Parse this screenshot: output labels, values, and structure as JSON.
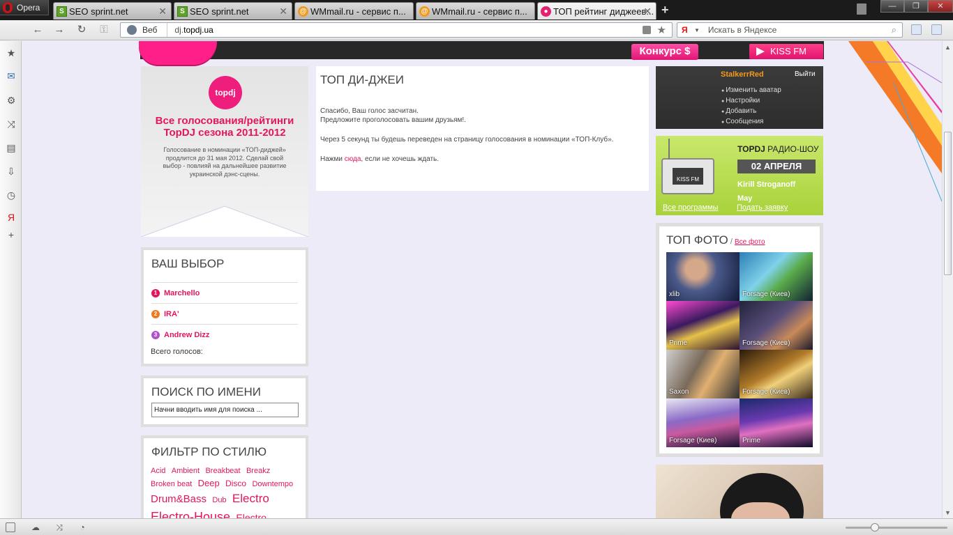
{
  "browser": {
    "menu_label": "Opera",
    "tabs": [
      {
        "title": "SEO sprint.net",
        "icon": "seo-favicon",
        "active": false
      },
      {
        "title": "SEO sprint.net",
        "icon": "seo-favicon",
        "active": false
      },
      {
        "title": "WMmail.ru - сервис п...",
        "icon": "wmmail-favicon",
        "active": false
      },
      {
        "title": "WMmail.ru - сервис п...",
        "icon": "wmmail-favicon",
        "active": false
      },
      {
        "title": "ТОП рейтинг диджеев...",
        "icon": "topdj-favicon",
        "active": true
      }
    ],
    "address": {
      "scope_label": "Веб",
      "url_prefix": "dj.",
      "url_host": "topdj.ua"
    },
    "search": {
      "engine_label": "Я",
      "placeholder": "Искать в Яндексе"
    }
  },
  "site_header": {
    "contest_label": "Конкурс $",
    "kiss_label": "KISS FM"
  },
  "promo": {
    "logo_text": "topdj",
    "title": "Все голосования/рейтинги TopDJ сезона 2011-2012",
    "text": "Голосование в номинации «ТОП-диджей» продлится до 31 мая 2012. Сделай свой выбор - повлияй на дальнейшее развитие украинской дэнс-сцены."
  },
  "vybor": {
    "title": "ВАШ ВЫБОР",
    "items": [
      {
        "num": "1",
        "name": "Marchello",
        "color": "#e3155f"
      },
      {
        "num": "2",
        "name": "IRA'",
        "color": "#f0771f"
      },
      {
        "num": "3",
        "name": "Andrew Dizz",
        "color": "#b24fd1"
      }
    ],
    "total_label": "Всего голосов:"
  },
  "poisk": {
    "title": "ПОИСК ПО ИМЕНИ",
    "value": "Начни вводить имя для поиска ..."
  },
  "filtr": {
    "title": "ФИЛЬТР ПО СТИЛЮ",
    "tags": [
      "Acid",
      "Ambient",
      "Breakbeat",
      "Breakz",
      "Broken beat",
      "Deep",
      "Disco",
      "Downtempo",
      "Drum&Bass",
      "Dub",
      "Electro",
      "Electro-House",
      "Electro-"
    ]
  },
  "content": {
    "title": "ТОП ДИ-ДЖЕИ",
    "line1": "Спасибо, Ваш голос засчитан.",
    "line2": "Предложите проголосовать вашим друзьям!.",
    "line3": "Через 5 секунд ты будешь переведен на страницу голосования в номинации «ТОП-Клуб».",
    "line4_pre": "Нажми ",
    "line4_link": "сюда",
    "line4_post": ", если не хочешь ждать."
  },
  "user": {
    "name": "StalkerrRed",
    "logout": "Выйти",
    "links": [
      "Изменить аватар",
      "Настройки",
      "Добавить",
      "Сообщения"
    ]
  },
  "radio": {
    "device_label": "KISS FM",
    "title_bold": "TOPDJ",
    "title_rest": " РАДИО-ШОУ",
    "date": "02 АПРЕЛЯ",
    "dj1": "Kirill Stroganoff",
    "dj2": "May",
    "link_all": "Все программы",
    "link_apply": "Подать заявку"
  },
  "topfoto": {
    "title": "ТОП ФОТО",
    "sep": " / ",
    "all_link": "Все фото",
    "photos": [
      "xlib",
      "Forsage (Киев)",
      "Prime",
      "Forsage (Киев)",
      "Saxon",
      "Forsage (Киев)",
      "Forsage (Киев)",
      "Prime"
    ]
  }
}
